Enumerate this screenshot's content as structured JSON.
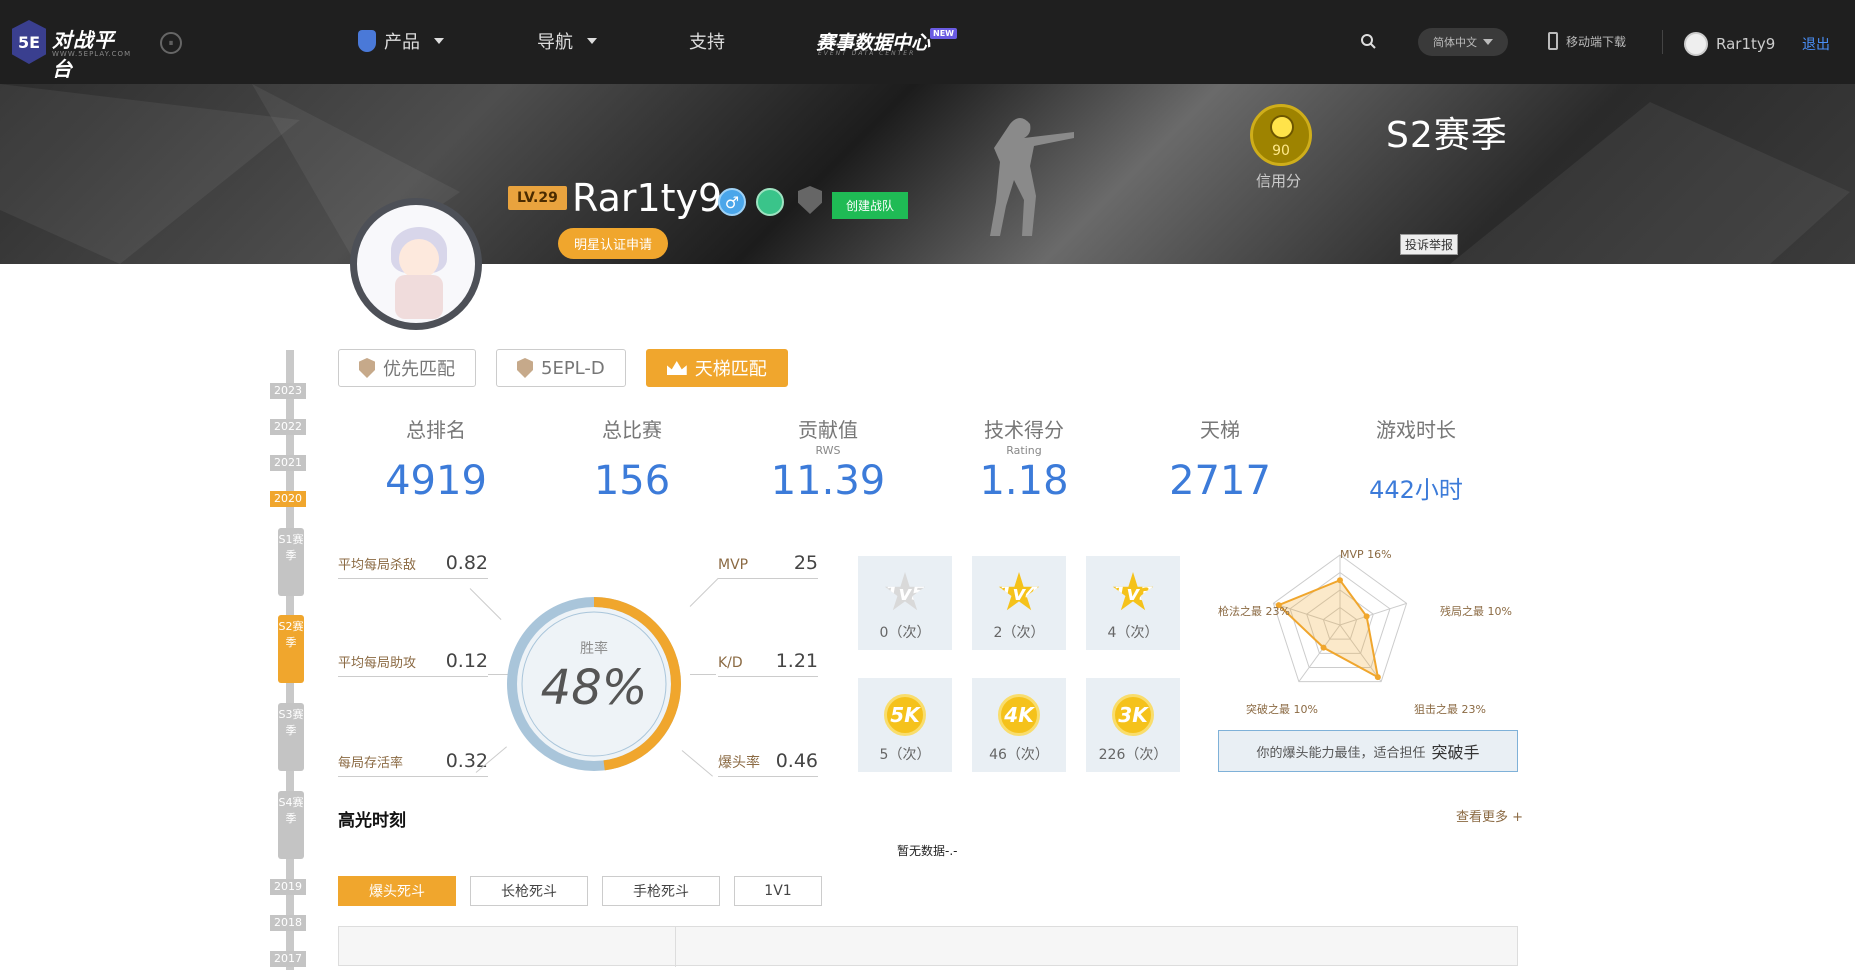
{
  "header": {
    "logo_text": "对战平台",
    "logo_badge": "5E",
    "logo_sub": "WWW.5EPLAY.COM",
    "nav": [
      {
        "label": "产品",
        "has_dropdown": true,
        "icon": "product-icon"
      },
      {
        "label": "导航",
        "has_dropdown": true
      },
      {
        "label": "支持",
        "has_dropdown": false
      }
    ],
    "event_center": "赛事数据中心",
    "event_center_sub": "EVENT DATA CENTER",
    "new_badge": "NEW",
    "language": "简体中文",
    "mobile_download": "移动端下载",
    "username": "Rar1ty9",
    "logout": "退出"
  },
  "banner": {
    "level": "LV.29",
    "player_name": "Rar1ty9",
    "gender_symbol": "♂",
    "create_team": "创建战队",
    "star_apply": "明星认证申请",
    "credit_score": "90",
    "credit_label": "信用分",
    "season_title": "S2赛季",
    "report": "投诉举报"
  },
  "timeline": {
    "years_top": [
      "2023",
      "2022",
      "2021",
      "2020"
    ],
    "seasons": [
      {
        "label": "S1赛季",
        "active": false
      },
      {
        "label": "S2赛季",
        "active": true
      },
      {
        "label": "S3赛季",
        "active": false
      },
      {
        "label": "S4赛季",
        "active": false
      }
    ],
    "years_bottom": [
      "2019",
      "2018",
      "2017"
    ]
  },
  "mode_tabs": [
    {
      "label": "优先匹配",
      "active": false,
      "icon": "shield-icon"
    },
    {
      "label": "5EPL-D",
      "active": false,
      "icon": "shield-icon"
    },
    {
      "label": "天梯匹配",
      "active": true,
      "icon": "crown-icon"
    }
  ],
  "stats": [
    {
      "label": "总排名",
      "sub": "",
      "value": "4919"
    },
    {
      "label": "总比赛",
      "sub": "",
      "value": "156"
    },
    {
      "label": "贡献值",
      "sub": "RWS",
      "value": "11.39"
    },
    {
      "label": "技术得分",
      "sub": "Rating",
      "value": "1.18"
    },
    {
      "label": "天梯",
      "sub": "",
      "value": "2717"
    },
    {
      "label": "游戏时长",
      "sub": "",
      "value": "442小时"
    }
  ],
  "left_stats": [
    {
      "label": "平均每局杀敌",
      "value": "0.82"
    },
    {
      "label": "平均每局助攻",
      "value": "0.12"
    },
    {
      "label": "每局存活率",
      "value": "0.32"
    }
  ],
  "right_stats": [
    {
      "label": "MVP",
      "value": "25"
    },
    {
      "label": "K/D",
      "value": "1.21"
    },
    {
      "label": "爆头率",
      "value": "0.46"
    }
  ],
  "win_rate": {
    "label": "胜率",
    "value": "48%",
    "fraction": 0.48
  },
  "awards": [
    {
      "name": "1v5",
      "count": "0（次）",
      "style": "star-grey"
    },
    {
      "name": "1v4",
      "count": "2（次）",
      "style": "star"
    },
    {
      "name": "1v3",
      "count": "4（次）",
      "style": "star"
    },
    {
      "name": "5K",
      "count": "5（次）",
      "style": "coin"
    },
    {
      "name": "4K",
      "count": "46（次）",
      "style": "coin"
    },
    {
      "name": "3K",
      "count": "226（次）",
      "style": "coin"
    }
  ],
  "radar": {
    "axes": [
      {
        "label": "MVP 16%",
        "value": 0.16
      },
      {
        "label": "残局之最 10%",
        "value": 0.1
      },
      {
        "label": "狙击之最 23%",
        "value": 0.23
      },
      {
        "label": "突破之最 10%",
        "value": 0.1
      },
      {
        "label": "枪法之最 23%",
        "value": 0.23
      }
    ],
    "tip_text": "你的爆头能力最佳，适合担任",
    "tip_role": "突破手"
  },
  "highlights": {
    "title": "高光时刻",
    "see_more": "查看更多 +",
    "empty": "暂无数据-.-",
    "tabs": [
      {
        "label": "爆头死斗",
        "active": true
      },
      {
        "label": "长枪死斗",
        "active": false
      },
      {
        "label": "手枪死斗",
        "active": false
      },
      {
        "label": "1V1",
        "active": false
      }
    ]
  },
  "colors": {
    "accent": "#f0a62d",
    "blue_value": "#3c7bd9",
    "donut_blue": "#a9c5da",
    "green": "#1fbb55"
  }
}
